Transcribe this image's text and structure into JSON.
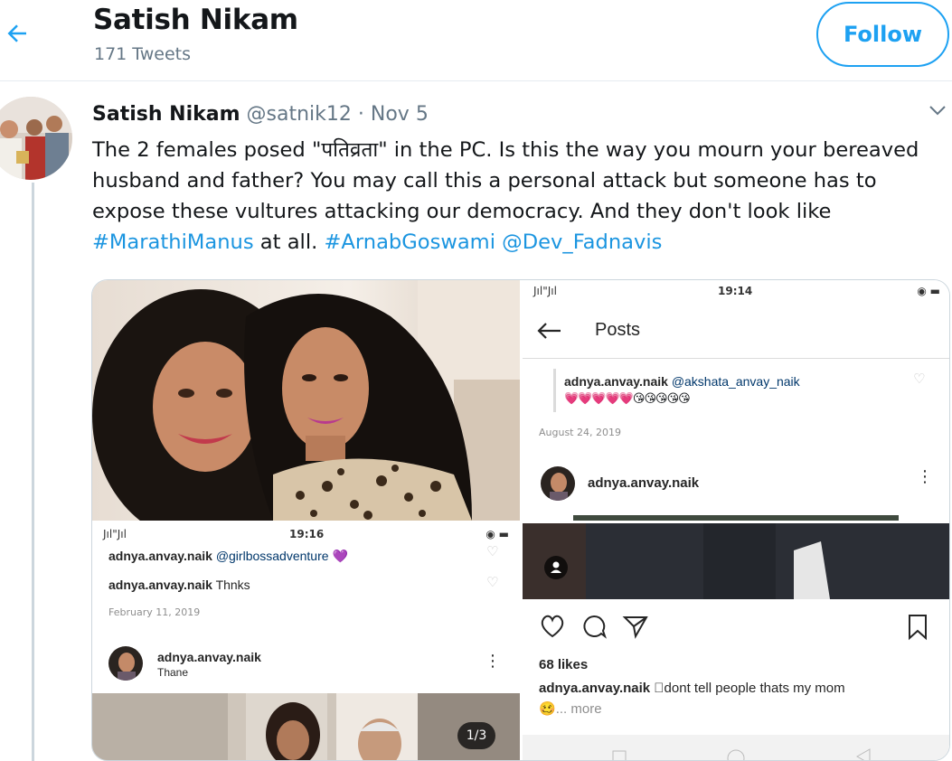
{
  "header": {
    "name": "Satish Nikam",
    "tweet_count": "171 Tweets",
    "follow_label": "Follow"
  },
  "tweet": {
    "author_name": "Satish Nikam",
    "handle": "@satnik12",
    "separator": "·",
    "date": "Nov 5",
    "text_1": "The 2 females posed \"पतिव्रता\" in the PC. Is this the way you mourn your bereaved husband and father?  You may call this a personal attack but someone has to expose these vultures attacking our democracy. And they don't look like ",
    "hashtag_1": "#MarathiManus",
    "text_2": " at all. ",
    "hashtag_2": "#ArnabGoswami",
    "text_3": " ",
    "mention_1": "@Dev_Fadnavis"
  },
  "media": {
    "shot_top_right": {
      "signal": "Jıl\"Jıl",
      "time": "19:14",
      "title": "Posts",
      "comment_user": "adnya.anvay.naik",
      "comment_mention": "@akshata_anvay_naik",
      "comment_emoji": "💗💗💗💗💗😘😘😘😘😘",
      "comment_date": "August 24, 2019",
      "post_user": "adnya.anvay.naik"
    },
    "shot_bottom_left": {
      "signal": "Jıl\"Jıl",
      "time": "19:16",
      "c1_user": "adnya.anvay.naik",
      "c1_mention": "@girlbossadventure",
      "c1_emoji": "💜",
      "c2_user": "adnya.anvay.naik",
      "c2_text": "Thnks",
      "date": "February 11, 2019",
      "post_user": "adnya.anvay.naik",
      "post_location": "Thane",
      "counter": "1/3"
    },
    "shot_bottom_right": {
      "likes": "68 likes",
      "caption_user": "adnya.anvay.naik",
      "caption_text": "\u0000dont tell people thats my mom",
      "caption_emoji": "🥴",
      "more": "... more"
    }
  },
  "colors": {
    "twitter_blue": "#1da1f2",
    "link_blue": "#1b95e0",
    "secondary_text": "#657786"
  }
}
